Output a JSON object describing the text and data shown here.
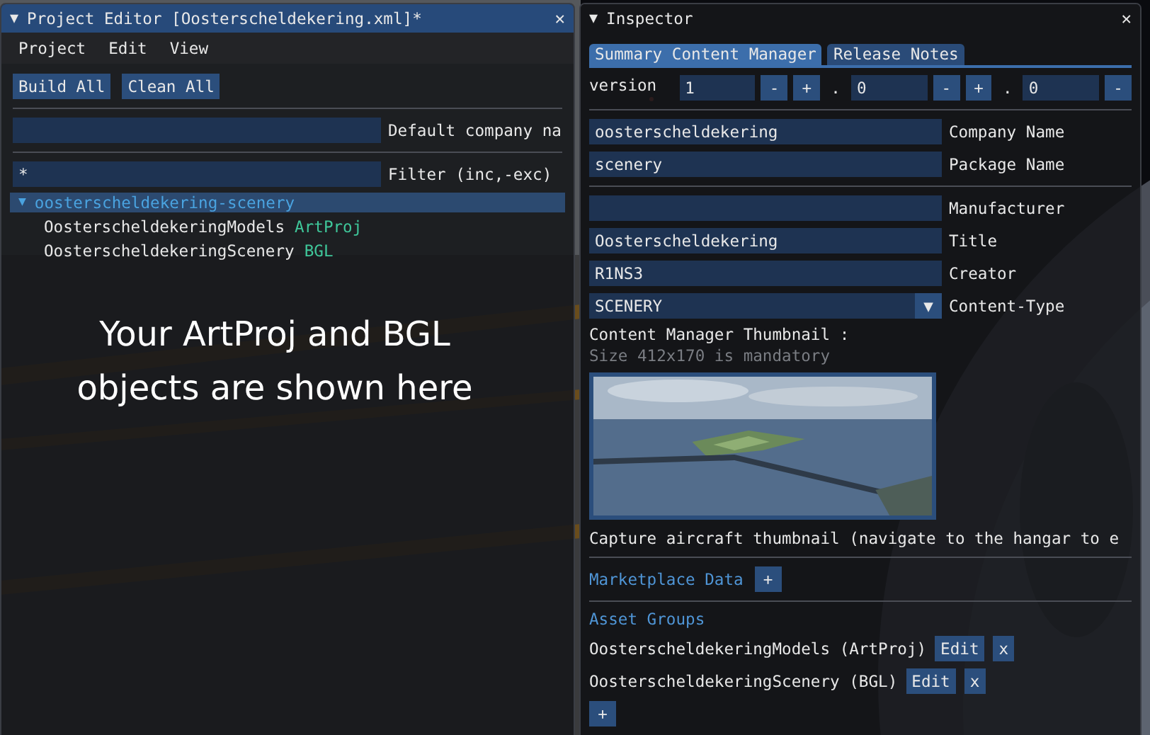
{
  "project_editor": {
    "title_arrow": "▼",
    "title": "Project Editor [Oosterscheldekering.xml]*",
    "close": "✕",
    "menu": [
      "Project",
      "Edit",
      "View"
    ],
    "buttons": [
      "Build All",
      "Clean All"
    ],
    "company_field": {
      "label": "Default company na"
    },
    "filter": {
      "value": "*",
      "label": "Filter (inc,-exc)"
    },
    "tree": [
      {
        "arrow": "▼",
        "label": "oosterscheldekering-scenery",
        "expanded": true,
        "selected": true,
        "children": [
          {
            "name": "OosterscheldekeringModels",
            "type": "ArtProj"
          },
          {
            "name": "OosterscheldekeringScenery",
            "type": "BGL"
          }
        ]
      }
    ]
  },
  "overlay_note": [
    "Your ArtProj and BGL",
    "objects are shown here"
  ],
  "inspector": {
    "title_arrow": "▼",
    "title": "Inspector",
    "close": "✕",
    "tabs": [
      {
        "label": "Summary Content Manager",
        "selected": true
      },
      {
        "label": "Release Notes",
        "selected": false
      }
    ],
    "version": {
      "label": "version",
      "parts": [
        {
          "value": "1",
          "buttons": [
            "-",
            "+"
          ],
          "separator": "."
        },
        {
          "value": "0",
          "buttons": [
            "-",
            "+"
          ],
          "separator": "."
        },
        {
          "value": "0",
          "buttons": [
            "-"
          ]
        }
      ]
    },
    "field_groups": [
      [
        {
          "kind": "text",
          "value": "oosterscheldekering",
          "label": "Company Name"
        },
        {
          "kind": "text",
          "value": "scenery",
          "label": "Package Name"
        }
      ],
      [
        {
          "kind": "text",
          "label": "Manufacturer"
        },
        {
          "kind": "text",
          "value": "Oosterscheldekering",
          "label": "Title"
        },
        {
          "kind": "text",
          "value": "R1NS3",
          "label": "Creator"
        },
        {
          "kind": "dropdown",
          "value": "SCENERY",
          "arrow": "▼",
          "label": "Content-Type"
        }
      ]
    ],
    "thumbnail": {
      "heading": "Content Manager Thumbnail :",
      "hint": "Size 412x170 is mandatory",
      "kind": "picture"
    },
    "capture_text": "Capture aircraft thumbnail (navigate to the hangar to e",
    "marketplace": {
      "heading": "Marketplace Data",
      "button": "+"
    },
    "asset_groups": {
      "heading": "Asset Groups",
      "items": [
        {
          "name": "OosterscheldekeringModels (ArtProj)",
          "buttons": [
            "Edit",
            "x"
          ]
        },
        {
          "name": "OosterscheldekeringScenery (BGL)",
          "buttons": [
            "Edit",
            "x"
          ]
        }
      ],
      "add_button": "+"
    }
  }
}
